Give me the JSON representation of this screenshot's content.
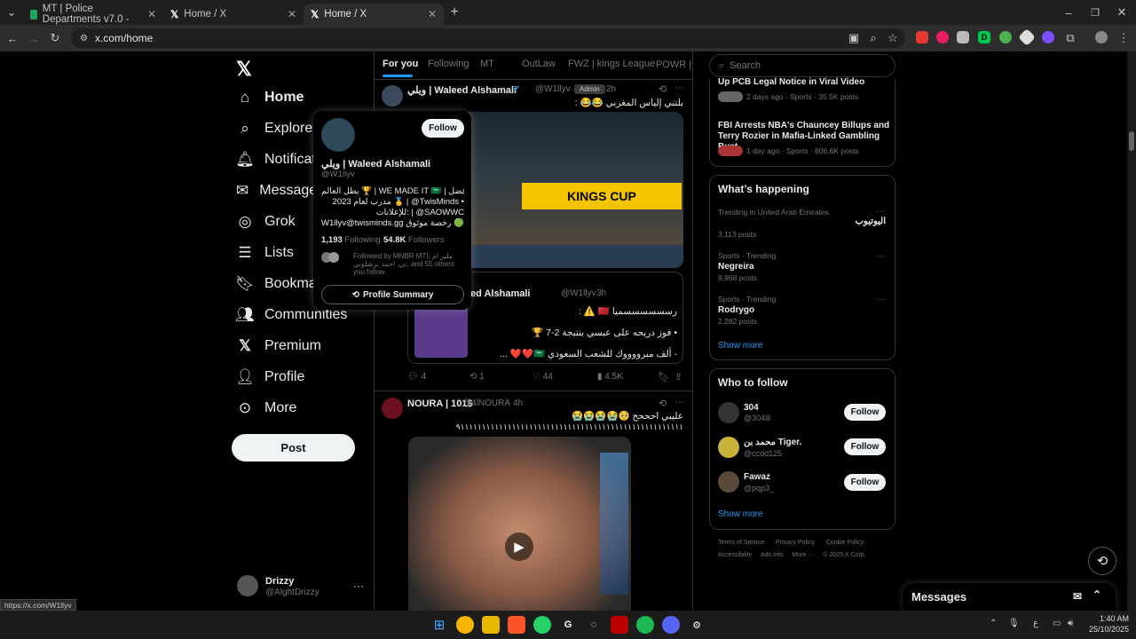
{
  "browser": {
    "tabs": [
      {
        "title": "MT | Police Departments v7.0 -"
      },
      {
        "title": "Home / X"
      },
      {
        "title": "Home / X"
      }
    ],
    "url": "x.com/home",
    "status_url": "https://x.com/W1llyv"
  },
  "nav": {
    "items": [
      {
        "label": "Home",
        "icon": "home-icon"
      },
      {
        "label": "Explore",
        "icon": "search-icon"
      },
      {
        "label": "Notifications",
        "icon": "bell-icon"
      },
      {
        "label": "Messages",
        "icon": "mail-icon"
      },
      {
        "label": "Grok",
        "icon": "grok-icon"
      },
      {
        "label": "Lists",
        "icon": "list-icon"
      },
      {
        "label": "Bookmarks",
        "icon": "bookmark-icon"
      },
      {
        "label": "Communities",
        "icon": "communities-icon"
      },
      {
        "label": "Premium",
        "icon": "x-icon"
      },
      {
        "label": "Profile",
        "icon": "person-icon"
      },
      {
        "label": "More",
        "icon": "more-icon"
      }
    ],
    "post_label": "Post",
    "account": {
      "name": "Drizzy",
      "handle": "@AlghtDrizzy"
    }
  },
  "timeline": {
    "tabs": [
      "For you",
      "Following",
      "MT",
      "OutLaw",
      "FWZ | kings League",
      "POWR | ور"
    ],
    "tweet1": {
      "name": "ويلي | Waleed Alshamali",
      "handle": "@W1llyv",
      "badge": "Admin",
      "time": "2h",
      "text": "بلتني إلياس المغربي 😂😂 :",
      "quoted": {
        "name": "ed Alshamali",
        "handle": "@W1llyv",
        "time": "3h",
        "line1": "رسسسسسسميا 🇲🇦 ⚠️ :",
        "line2": "• فوز دريحه على عبسي بنتيجة 2-7 🏆",
        "line3": "- ألف مبرووووك للشعب السعودي 🇸🇦❤️❤️ ..."
      },
      "stats": {
        "replies": "4",
        "reposts": "1",
        "likes": "44",
        "views": "4.5K"
      }
    },
    "tweet2": {
      "name": "NOURA | 101$",
      "handle": "@4lNOURA",
      "time": "4h",
      "line1": "عليبي احححح 🥺😭😭😭😭",
      "line2": "٩١١١١١١١١١١١١١١١١١١١١١١١١١١١١١١١١١١١١١١١١١١١١١١١١١١١١"
    }
  },
  "popup": {
    "name": "ويلي | Waleed Alshamali",
    "handle": "@W1llyv",
    "follow": "Follow",
    "bio1": "بطل العالم 🏆 | WE MADE IT 🇸🇦 | افضل",
    "bio2": "مدرب لعام 2023 🥇 | @TwisMinds •",
    "bio3": "للإعلانات: | @SAOWWC",
    "bio4": "W1llyv@twisminds.gg رخصة موثوق 🟢",
    "following": "1,193",
    "following_label": "Following",
    "followers": "54.8K",
    "followers_label": "Followers",
    "followed_by": "Followed by MNBR MTI, ملير ام تي, احمد برشلوني, and 55 others you follow",
    "summary": "Profile Summary"
  },
  "right": {
    "search_placeholder": "Search",
    "news": [
      {
        "title": "Up PCB Legal Notice in Viral Video",
        "meta": "2 days ago · Sports · 35.5K posts"
      },
      {
        "title": "FBI Arrests NBA's Chauncey Billups and Terry Rozier in Mafia-Linked Gambling Bust",
        "meta": "1 day ago · Sports · 606.6K posts"
      }
    ],
    "happening_title": "What’s happening",
    "trends": [
      {
        "context": "Trending in United Arab Emirates",
        "name": "اليوتيوب",
        "posts": "3,113 posts"
      },
      {
        "context": "Sports · Trending",
        "name": "Negreira",
        "posts": "9,968 posts"
      },
      {
        "context": "Sports · Trending",
        "name": "Rodrygo",
        "posts": "2,282 posts"
      }
    ],
    "show_more": "Show more",
    "wtf_title": "Who to follow",
    "follows": [
      {
        "name": "304",
        "handle": "@304lll"
      },
      {
        "name": "محمد بن Tiger.",
        "handle": "@ccdd125"
      },
      {
        "name": "Fawaz",
        "handle": "@pqp3_"
      }
    ],
    "follow_label": "Follow",
    "footer1": [
      "Terms of Service",
      "Privacy Policy",
      "Cookie Policy"
    ],
    "footer2": [
      "Accessibility",
      "Ads info",
      "More ···",
      "© 2025 X Corp."
    ]
  },
  "messages": {
    "title": "Messages"
  },
  "taskbar": {
    "time": "1:40 AM",
    "date": "25/10/2025",
    "lang": "ع"
  }
}
